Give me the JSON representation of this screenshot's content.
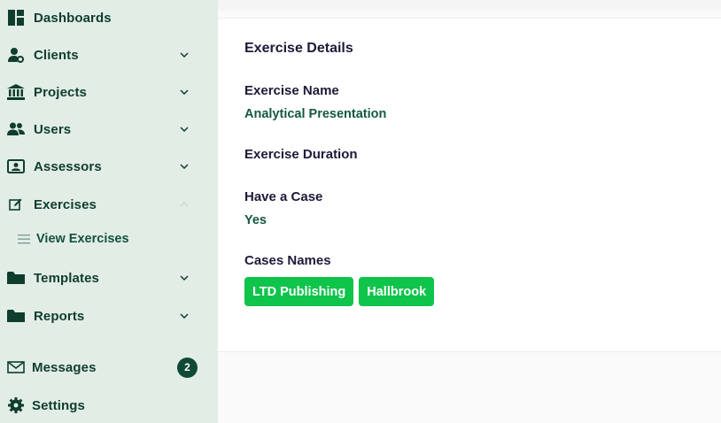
{
  "sidebar": {
    "items": [
      {
        "label": "Dashboards",
        "icon": "dashboard-icon"
      },
      {
        "label": "Clients",
        "icon": "user-gear-icon"
      },
      {
        "label": "Projects",
        "icon": "bank-icon"
      },
      {
        "label": "Users",
        "icon": "users-icon"
      },
      {
        "label": "Assessors",
        "icon": "id-card-icon"
      },
      {
        "label": "Exercises",
        "icon": "edit-icon"
      },
      {
        "label": "View Exercises",
        "icon": "list-icon"
      },
      {
        "label": "Templates",
        "icon": "folder-icon"
      },
      {
        "label": "Reports",
        "icon": "folder-icon"
      },
      {
        "label": "Messages",
        "icon": "envelope-icon",
        "badge": "2"
      },
      {
        "label": "Settings",
        "icon": "gear-icon"
      }
    ]
  },
  "details": {
    "title": "Exercise Details",
    "exercise_name_label": "Exercise Name",
    "exercise_name_value": "Analytical Presentation",
    "exercise_duration_label": "Exercise Duration",
    "exercise_duration_value": "",
    "have_case_label": "Have a Case",
    "have_case_value": "Yes",
    "cases_names_label": "Cases Names",
    "cases": [
      "LTD Publishing",
      "Hallbrook"
    ]
  },
  "colors": {
    "sidebar_bg": "#e2ede6",
    "primary": "#0f3d2e",
    "tag_green": "#0fc44a",
    "badge_bg": "#0f4a37"
  }
}
